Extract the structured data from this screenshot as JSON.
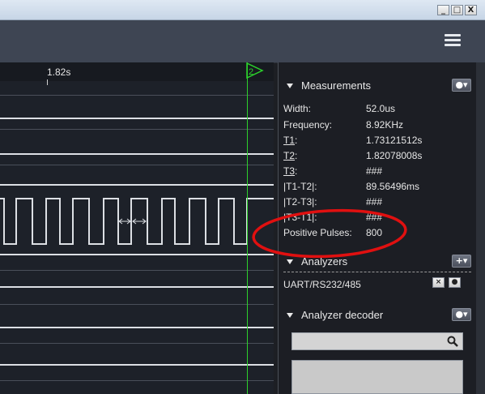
{
  "window": {
    "controls": [
      "_",
      "□",
      "X"
    ]
  },
  "timeline": {
    "tick_label": "1.82s",
    "cursor_label": "2"
  },
  "measurements": {
    "title": "Measurements",
    "rows": [
      {
        "label": "Width:",
        "value": "52.0us"
      },
      {
        "label": "Frequency:",
        "value": "8.92KHz"
      },
      {
        "label": "T1",
        "suffix": ":",
        "value": "1.73121512s"
      },
      {
        "label": "T2",
        "suffix": ":",
        "value": "1.82078008s"
      },
      {
        "label": "T3",
        "suffix": ":",
        "value": "###"
      },
      {
        "label": "|T1-T2|:",
        "value": "89.56496ms"
      },
      {
        "label": "|T2-T3|:",
        "value": "###"
      },
      {
        "label": "|T3-T1|:",
        "value": "###"
      },
      {
        "label": "Positive Pulses:",
        "value": "800"
      }
    ]
  },
  "analyzers": {
    "title": "Analyzers",
    "items": [
      {
        "label": "UART/RS232/485"
      }
    ]
  },
  "decoder": {
    "title": "Analyzer decoder",
    "search_placeholder": ""
  },
  "icons": {
    "menu": "hamburger-menu-icon",
    "gear": "gear-icon",
    "add": "plus-icon",
    "close": "close-icon",
    "search": "magnifier-icon"
  },
  "colors": {
    "cursor": "#2cd12c",
    "annotation": "#e01010",
    "signal": "#dcdfe4"
  }
}
